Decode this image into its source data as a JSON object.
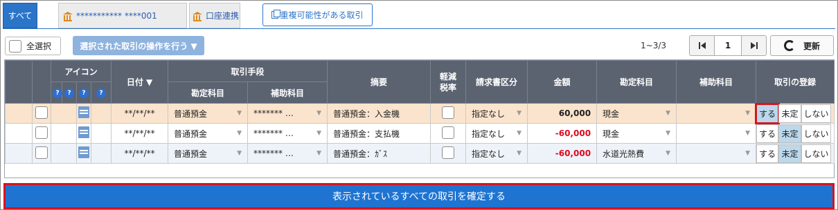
{
  "tabs": {
    "all": "すべて",
    "account": "*********** ****001",
    "link": "口座連携"
  },
  "duplicate_button": "重複可能性がある取引",
  "toolbar": {
    "select_all": "全選択",
    "bulk_action": "選択された取引の操作を行う ▼",
    "page_range": "1~3/3",
    "page_number": "1",
    "refresh": "更新"
  },
  "table": {
    "headers": {
      "icon": "アイコン",
      "q": "?",
      "date": "日付 ▼",
      "method": "取引手段",
      "account_item": "勘定科目",
      "sub_item": "補助科目",
      "summary": "摘要",
      "reduced_tax": "軽減\n税率",
      "invoice": "請求書区分",
      "amount": "金額",
      "item": "勘定科目",
      "sub": "補助科目",
      "register": "取引の登録"
    },
    "rows": [
      {
        "date": "**/**/**",
        "method": "普通預金",
        "method_sub": "******* …",
        "summary": "普通預金：入金機",
        "invoice": "指定なし",
        "amount": "60,000",
        "negative": false,
        "item": "現金",
        "do": "する",
        "pending": "未定",
        "no": "しない",
        "selected": "do"
      },
      {
        "date": "**/**/**",
        "method": "普通預金",
        "method_sub": "******* …",
        "summary": "普通預金：支払機",
        "invoice": "指定なし",
        "amount": "-60,000",
        "negative": true,
        "item": "現金",
        "do": "する",
        "pending": "未定",
        "no": "しない",
        "selected": "pending"
      },
      {
        "date": "**/**/**",
        "method": "普通預金",
        "method_sub": "******* …",
        "summary": "普通預金：ｶﾞｽ",
        "invoice": "指定なし",
        "amount": "-60,000",
        "negative": true,
        "item": "水道光熱費",
        "do": "する",
        "pending": "未定",
        "no": "しない",
        "selected": "pending"
      }
    ]
  },
  "confirm_button": "表示されているすべての取引を確定する",
  "colors": {
    "accent": "#1f74d2",
    "header": "#5b6371",
    "highlight": "#d8141c",
    "negative": "#e00a1f"
  }
}
